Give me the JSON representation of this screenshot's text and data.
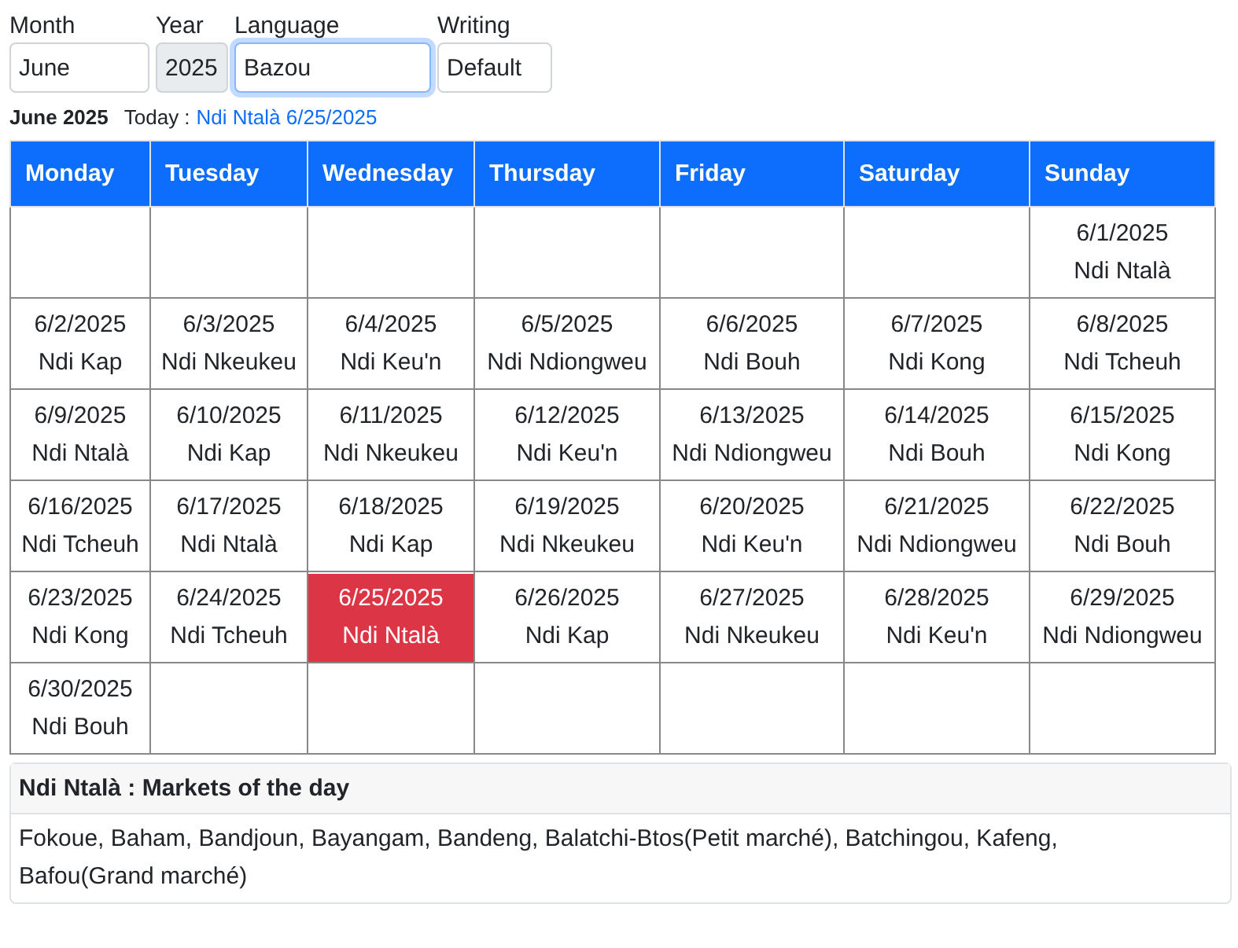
{
  "fields": [
    {
      "label": "Month",
      "value": "June",
      "disabled": false,
      "focused": false
    },
    {
      "label": "Year",
      "value": "2025",
      "disabled": true,
      "focused": false
    },
    {
      "label": "Language",
      "value": "Bazou",
      "disabled": false,
      "focused": true
    },
    {
      "label": "Writing",
      "value": "Default",
      "disabled": false,
      "focused": false
    }
  ],
  "heading": {
    "title": "June 2025",
    "today_label": "Today :",
    "today_link": "Ndi Ntalà 6/25/2025"
  },
  "calendar": {
    "columns": [
      "Monday",
      "Tuesday",
      "Wednesday",
      "Thursday",
      "Friday",
      "Saturday",
      "Sunday"
    ],
    "weeks": [
      [
        {
          "kind": "blank"
        },
        {
          "kind": "blank"
        },
        {
          "kind": "blank"
        },
        {
          "kind": "blank"
        },
        {
          "kind": "blank"
        },
        {
          "kind": "blank"
        },
        {
          "kind": "day",
          "date": "6/1/2025",
          "day": "Ndi Ntalà",
          "selected": false
        }
      ],
      [
        {
          "kind": "day",
          "date": "6/2/2025",
          "day": "Ndi Kap",
          "selected": false
        },
        {
          "kind": "day",
          "date": "6/3/2025",
          "day": "Ndi Nkeukeu",
          "selected": false
        },
        {
          "kind": "day",
          "date": "6/4/2025",
          "day": "Ndi Keu'n",
          "selected": false
        },
        {
          "kind": "day",
          "date": "6/5/2025",
          "day": "Ndi Ndiongweu",
          "selected": false
        },
        {
          "kind": "day",
          "date": "6/6/2025",
          "day": "Ndi Bouh",
          "selected": false
        },
        {
          "kind": "day",
          "date": "6/7/2025",
          "day": "Ndi Kong",
          "selected": false
        },
        {
          "kind": "day",
          "date": "6/8/2025",
          "day": "Ndi Tcheuh",
          "selected": false
        }
      ],
      [
        {
          "kind": "day",
          "date": "6/9/2025",
          "day": "Ndi Ntalà",
          "selected": false
        },
        {
          "kind": "day",
          "date": "6/10/2025",
          "day": "Ndi Kap",
          "selected": false
        },
        {
          "kind": "day",
          "date": "6/11/2025",
          "day": "Ndi Nkeukeu",
          "selected": false
        },
        {
          "kind": "day",
          "date": "6/12/2025",
          "day": "Ndi Keu'n",
          "selected": false
        },
        {
          "kind": "day",
          "date": "6/13/2025",
          "day": "Ndi Ndiongweu",
          "selected": false
        },
        {
          "kind": "day",
          "date": "6/14/2025",
          "day": "Ndi Bouh",
          "selected": false
        },
        {
          "kind": "day",
          "date": "6/15/2025",
          "day": "Ndi Kong",
          "selected": false
        }
      ],
      [
        {
          "kind": "day",
          "date": "6/16/2025",
          "day": "Ndi Tcheuh",
          "selected": false
        },
        {
          "kind": "day",
          "date": "6/17/2025",
          "day": "Ndi Ntalà",
          "selected": false
        },
        {
          "kind": "day",
          "date": "6/18/2025",
          "day": "Ndi Kap",
          "selected": false
        },
        {
          "kind": "day",
          "date": "6/19/2025",
          "day": "Ndi Nkeukeu",
          "selected": false
        },
        {
          "kind": "day",
          "date": "6/20/2025",
          "day": "Ndi Keu'n",
          "selected": false
        },
        {
          "kind": "day",
          "date": "6/21/2025",
          "day": "Ndi Ndiongweu",
          "selected": false
        },
        {
          "kind": "day",
          "date": "6/22/2025",
          "day": "Ndi Bouh",
          "selected": false
        }
      ],
      [
        {
          "kind": "day",
          "date": "6/23/2025",
          "day": "Ndi Kong",
          "selected": false
        },
        {
          "kind": "day",
          "date": "6/24/2025",
          "day": "Ndi Tcheuh",
          "selected": false
        },
        {
          "kind": "day",
          "date": "6/25/2025",
          "day": "Ndi Ntalà",
          "selected": true
        },
        {
          "kind": "day",
          "date": "6/26/2025",
          "day": "Ndi Kap",
          "selected": false
        },
        {
          "kind": "day",
          "date": "6/27/2025",
          "day": "Ndi Nkeukeu",
          "selected": false
        },
        {
          "kind": "day",
          "date": "6/28/2025",
          "day": "Ndi Keu'n",
          "selected": false
        },
        {
          "kind": "day",
          "date": "6/29/2025",
          "day": "Ndi Ndiongweu",
          "selected": false
        }
      ],
      [
        {
          "kind": "day",
          "date": "6/30/2025",
          "day": "Ndi Bouh",
          "selected": false
        },
        {
          "kind": "blank"
        },
        {
          "kind": "blank"
        },
        {
          "kind": "blank"
        },
        {
          "kind": "blank"
        },
        {
          "kind": "blank"
        },
        {
          "kind": "blank"
        }
      ]
    ]
  },
  "markets": {
    "title": "Ndi Ntalà : Markets of the day",
    "body": "Fokoue, Baham, Bandjoun, Bayangam, Bandeng, Balatchi-Btos(Petit marché), Batchingou, Kafeng, Bafou(Grand marché)"
  }
}
